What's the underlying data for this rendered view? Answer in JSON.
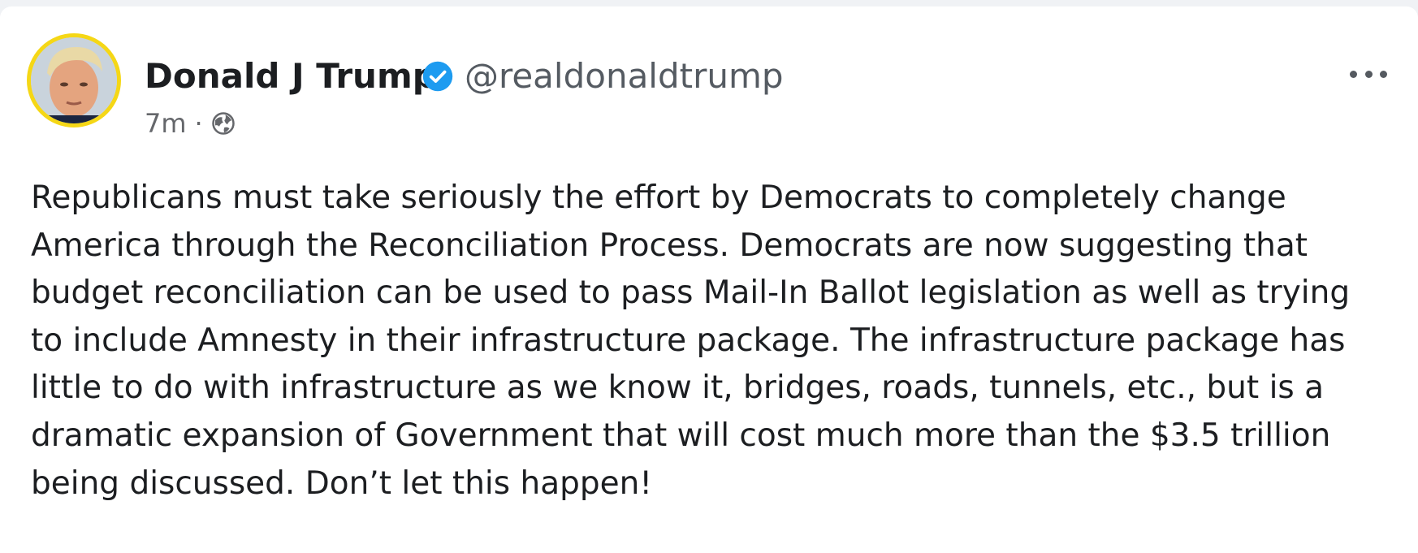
{
  "post": {
    "author_name": "Donald J Trump",
    "handle": "@realdonaldtrump",
    "timestamp": "7m",
    "separator": "·",
    "verified": true,
    "audience_icon": "globe-icon",
    "more_icon": "more-options-icon",
    "lines": [
      "Republicans must take seriously the effort by Democrats to completely change",
      "America through the Reconciliation Process. Democrats are now suggesting that",
      "budget reconciliation can be used to pass Mail-In Ballot legislation as well as trying",
      "to include Amnesty in their infrastructure package. The infrastructure package has",
      "little to do with infrastructure as we know it, bridges, roads, tunnels, etc., but is a",
      "dramatic expansion of Government that will cost much more than the $3.5 trillion",
      "being discussed. Don’t let this happen!"
    ]
  },
  "colors": {
    "verified_badge": "#1d9bf0",
    "avatar_ring": "#f5d716",
    "page_background": "#f0f2f5",
    "card_background": "#ffffff"
  }
}
